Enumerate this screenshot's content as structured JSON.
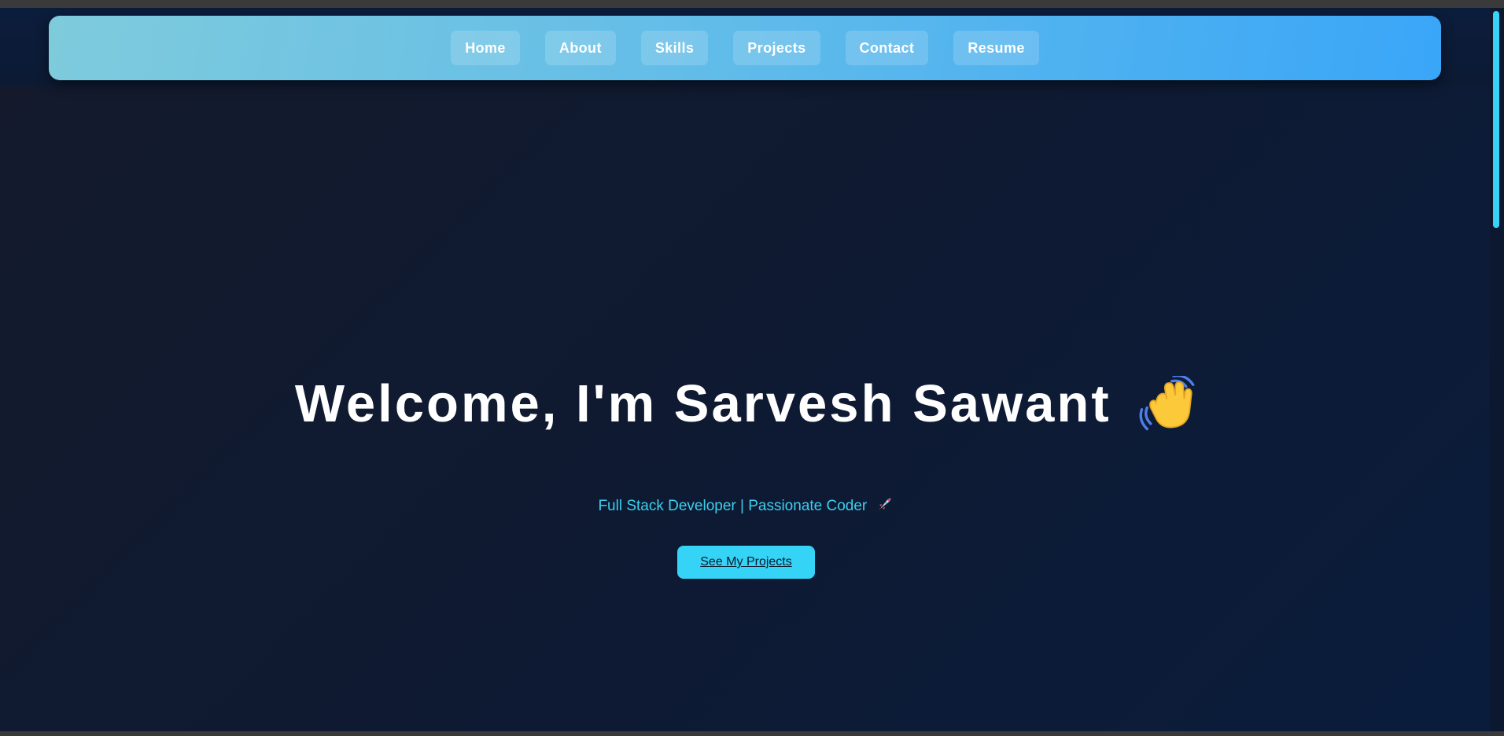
{
  "nav": {
    "items": [
      {
        "label": "Home"
      },
      {
        "label": "About"
      },
      {
        "label": "Skills"
      },
      {
        "label": "Projects"
      },
      {
        "label": "Contact"
      },
      {
        "label": "Resume"
      }
    ]
  },
  "hero": {
    "title": "Welcome, I'm Sarvesh Sawant",
    "title_icon": "waving-hand-icon",
    "subtitle": "Full Stack Developer | Passionate Coder",
    "subtitle_icon": "rocket-icon",
    "cta_label": "See My Projects"
  },
  "colors": {
    "nav_gradient_start": "#7ecbdc",
    "nav_gradient_end": "#3aa6f8",
    "accent": "#35d3f6",
    "subtitle": "#3ccfee",
    "background": "#0f1a31"
  }
}
